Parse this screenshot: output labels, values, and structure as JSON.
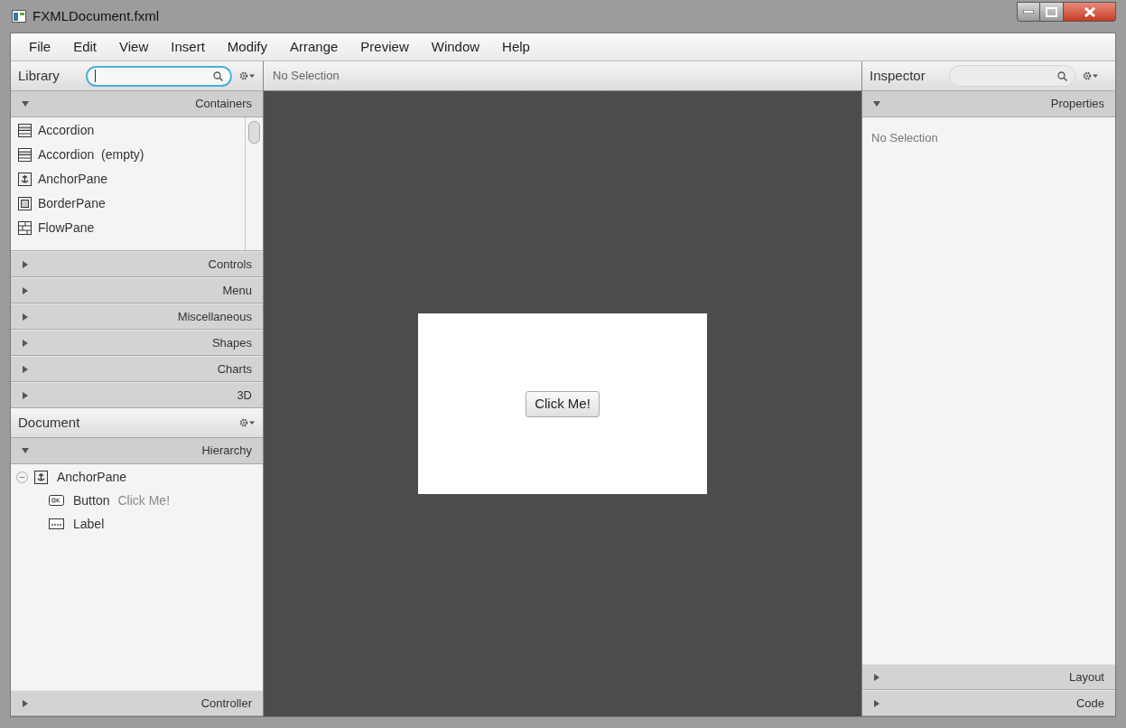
{
  "window": {
    "title": "FXMLDocument.fxml"
  },
  "menu": [
    "File",
    "Edit",
    "View",
    "Insert",
    "Modify",
    "Arrange",
    "Preview",
    "Window",
    "Help"
  ],
  "library": {
    "title": "Library",
    "search_focused": true,
    "sections": [
      {
        "title": "Containers",
        "expanded": true,
        "items": [
          {
            "label": "Accordion",
            "kind": "accordion"
          },
          {
            "label": "Accordion  (empty)",
            "kind": "accordion"
          },
          {
            "label": "AnchorPane",
            "kind": "anchor"
          },
          {
            "label": "BorderPane",
            "kind": "border"
          },
          {
            "label": "FlowPane",
            "kind": "flow"
          }
        ]
      },
      {
        "title": "Controls",
        "expanded": false
      },
      {
        "title": "Menu",
        "expanded": false
      },
      {
        "title": "Miscellaneous",
        "expanded": false
      },
      {
        "title": "Shapes",
        "expanded": false
      },
      {
        "title": "Charts",
        "expanded": false
      },
      {
        "title": "3D",
        "expanded": false
      }
    ]
  },
  "document": {
    "title": "Document",
    "sections": [
      {
        "title": "Hierarchy",
        "expanded": true,
        "tree": [
          {
            "label": "AnchorPane",
            "kind": "anchor",
            "expanded": true,
            "children": [
              {
                "label": "Button",
                "detail": "Click Me!",
                "kind": "button"
              },
              {
                "label": "Label",
                "kind": "label"
              }
            ]
          }
        ]
      },
      {
        "title": "Controller",
        "expanded": false
      }
    ]
  },
  "canvas": {
    "status": "No Selection",
    "button": "Click Me!"
  },
  "inspector": {
    "title": "Inspector",
    "sections": [
      {
        "title": "Properties",
        "expanded": true,
        "empty_text": "No Selection"
      },
      {
        "title": "Layout",
        "expanded": false
      },
      {
        "title": "Code",
        "expanded": false
      }
    ]
  }
}
